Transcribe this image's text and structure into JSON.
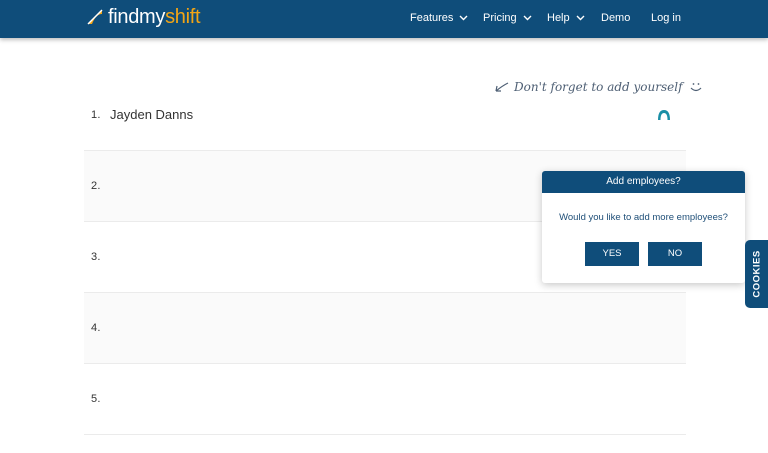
{
  "brand": {
    "name_part1": "findmy",
    "name_part2": "shift"
  },
  "nav": {
    "features": "Features",
    "pricing": "Pricing",
    "help": "Help",
    "demo": "Demo",
    "login": "Log in"
  },
  "hint": {
    "text": "Don't forget to add yourself"
  },
  "employees": [
    {
      "num": "1.",
      "name": "Jayden Danns"
    },
    {
      "num": "2.",
      "name": ""
    },
    {
      "num": "3.",
      "name": ""
    },
    {
      "num": "4.",
      "name": ""
    },
    {
      "num": "5.",
      "name": ""
    }
  ],
  "dialog": {
    "title": "Add employees?",
    "message": "Would you like to add more employees?",
    "yes": "YES",
    "no": "NO"
  },
  "cookies": {
    "label": "COOKIES"
  },
  "colors": {
    "primary": "#0f4d7a",
    "brand_accent": "#f2a515",
    "teal_icon": "#1a8fa6"
  }
}
